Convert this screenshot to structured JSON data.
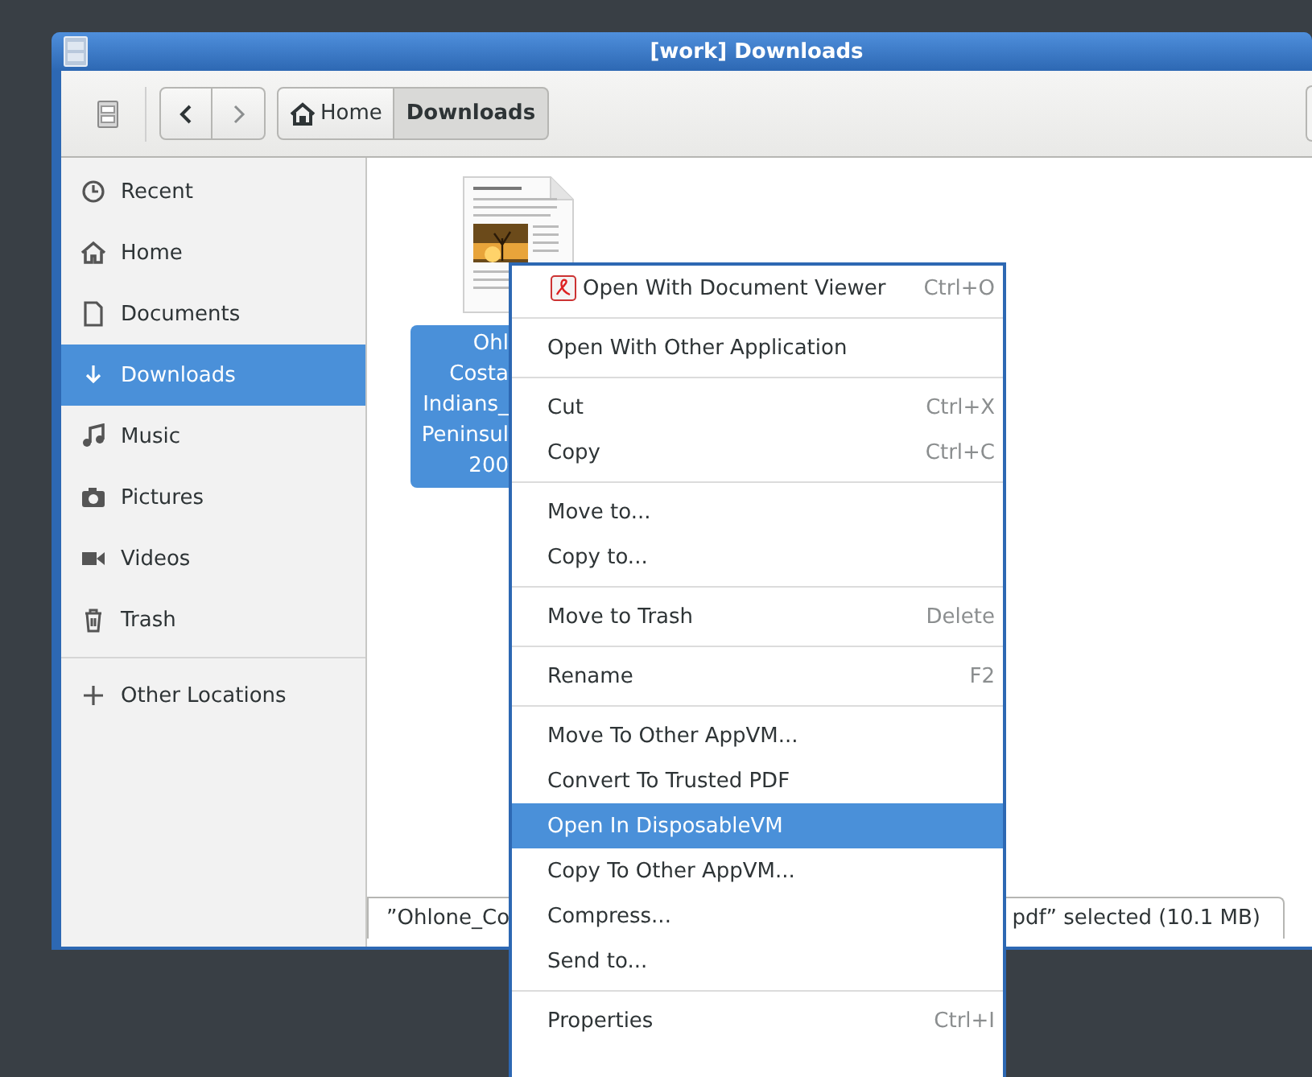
{
  "window": {
    "title": "[work] Downloads"
  },
  "path_bar": [
    {
      "label": "Home",
      "kind": "home",
      "selected": false
    },
    {
      "label": "Downloads",
      "kind": "folder",
      "selected": true
    }
  ],
  "sidebar": {
    "items": [
      {
        "label": "Recent",
        "kind": "recent",
        "selected": false
      },
      {
        "label": "Home",
        "kind": "home",
        "selected": false
      },
      {
        "label": "Documents",
        "kind": "documents",
        "selected": false
      },
      {
        "label": "Downloads",
        "kind": "downloads",
        "selected": true
      },
      {
        "label": "Music",
        "kind": "music",
        "selected": false
      },
      {
        "label": "Pictures",
        "kind": "pictures",
        "selected": false
      },
      {
        "label": "Videos",
        "kind": "videos",
        "selected": false
      },
      {
        "label": "Trash",
        "kind": "trash",
        "selected": false
      },
      {
        "label": "Other Locations",
        "kind": "other",
        "selected": false
      }
    ]
  },
  "files": [
    {
      "name_lines": [
        "Ohl",
        "Costa",
        "Indians_",
        "Peninsul",
        "200"
      ],
      "selected": true
    }
  ],
  "status_bar": {
    "text_start": "”Ohlone_Co",
    "text_end": "pdf” selected  (10.1 MB)"
  },
  "context_menu": [
    {
      "kind": "item",
      "label": "Open With Document Viewer",
      "shortcut": "Ctrl+O",
      "icon": true,
      "selected": false
    },
    {
      "kind": "separator"
    },
    {
      "kind": "item",
      "label": "Open With Other Application",
      "selected": false
    },
    {
      "kind": "separator"
    },
    {
      "kind": "item",
      "label": "Cut",
      "shortcut": "Ctrl+X",
      "selected": false
    },
    {
      "kind": "item",
      "label": "Copy",
      "shortcut": "Ctrl+C",
      "selected": false
    },
    {
      "kind": "separator"
    },
    {
      "kind": "item",
      "label": "Move to...",
      "selected": false
    },
    {
      "kind": "item",
      "label": "Copy to...",
      "selected": false
    },
    {
      "kind": "separator"
    },
    {
      "kind": "item",
      "label": "Move to Trash",
      "shortcut": "Delete",
      "selected": false
    },
    {
      "kind": "separator"
    },
    {
      "kind": "item",
      "label": "Rename",
      "shortcut": "F2",
      "selected": false
    },
    {
      "kind": "separator"
    },
    {
      "kind": "item",
      "label": "Move To Other AppVM...",
      "selected": false
    },
    {
      "kind": "item",
      "label": "Convert To Trusted PDF",
      "selected": false
    },
    {
      "kind": "item",
      "label": "Open In DisposableVM",
      "selected": true
    },
    {
      "kind": "item",
      "label": "Copy To Other AppVM...",
      "selected": false
    },
    {
      "kind": "item",
      "label": "Compress...",
      "selected": false
    },
    {
      "kind": "item",
      "label": "Send to...",
      "selected": false
    },
    {
      "kind": "separator"
    },
    {
      "kind": "item",
      "label": "Properties",
      "shortcut": "Ctrl+I",
      "selected": false
    }
  ]
}
